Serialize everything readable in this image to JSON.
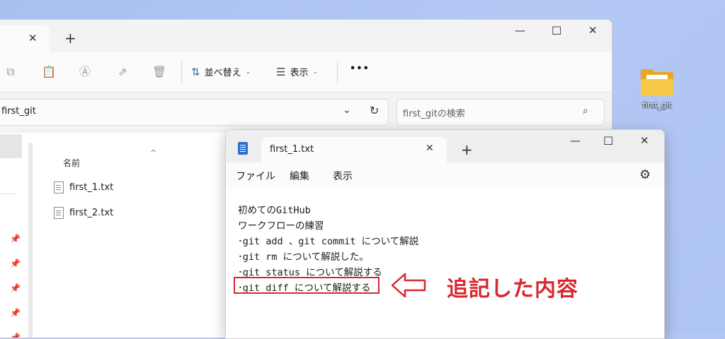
{
  "explorer": {
    "toolbar": {
      "sort_label": "並べ替え",
      "view_label": "表示",
      "more_label": "•••"
    },
    "address": "first_git",
    "search_placeholder": "first_gitの検索",
    "column_name": "名前",
    "files": [
      "first_1.txt",
      "first_2.txt"
    ],
    "new_tab_label": "+"
  },
  "desktop": {
    "icon_label": "first_git"
  },
  "notepad": {
    "tab_title": "first_1.txt",
    "new_tab_label": "+",
    "menu": [
      "ファイル",
      "編集",
      "表示"
    ],
    "lines": [
      "初めてのGitHub",
      "ワークフローの練習",
      "･git add 、git commit について解説",
      "･git rm について解説した。",
      "･git status について解説する",
      "･git diff について解説する"
    ]
  },
  "annotation": {
    "text": "追記した内容",
    "color": "#d8282e"
  }
}
